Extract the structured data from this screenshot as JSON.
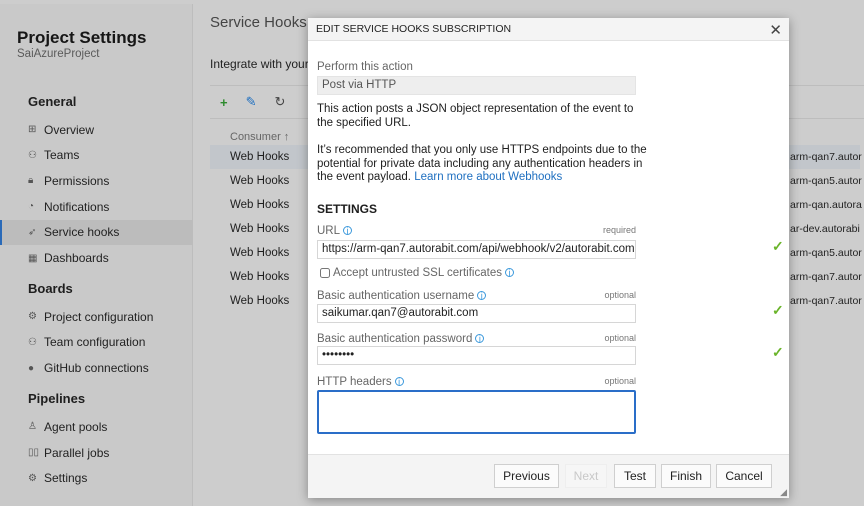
{
  "sidebar": {
    "title": "Project Settings",
    "project": "SaiAzureProject",
    "sections": [
      {
        "label": "General",
        "items": [
          {
            "label": "Overview",
            "icon": "overview-icon"
          },
          {
            "label": "Teams",
            "icon": "teams-icon"
          },
          {
            "label": "Permissions",
            "icon": "lock-icon"
          },
          {
            "label": "Notifications",
            "icon": "notification-icon"
          },
          {
            "label": "Service hooks",
            "icon": "rocket-icon",
            "selected": true
          },
          {
            "label": "Dashboards",
            "icon": "dashboard-icon"
          }
        ]
      },
      {
        "label": "Boards",
        "items": [
          {
            "label": "Project configuration",
            "icon": "project-config-icon"
          },
          {
            "label": "Team configuration",
            "icon": "team-config-icon"
          },
          {
            "label": "GitHub connections",
            "icon": "github-icon"
          }
        ]
      },
      {
        "label": "Pipelines",
        "items": [
          {
            "label": "Agent pools",
            "icon": "agent-icon"
          },
          {
            "label": "Parallel jobs",
            "icon": "parallel-icon"
          },
          {
            "label": "Settings",
            "icon": "gear-icon"
          }
        ]
      }
    ]
  },
  "main": {
    "title": "Service Hooks",
    "intro": "Integrate with your",
    "column_consumer": "Consumer ↑",
    "rows": [
      {
        "consumer": "Web Hooks",
        "url": "arm-qan7.autor"
      },
      {
        "consumer": "Web Hooks",
        "url": "arm-qan5.autor"
      },
      {
        "consumer": "Web Hooks",
        "url": "arm-qan.autora"
      },
      {
        "consumer": "Web Hooks",
        "url": "ar-dev.autorabi"
      },
      {
        "consumer": "Web Hooks",
        "url": "arm-qan5.autor"
      },
      {
        "consumer": "Web Hooks",
        "url": "arm-qan7.autor"
      },
      {
        "consumer": "Web Hooks",
        "url": "arm-qan7.autor"
      }
    ]
  },
  "dialog": {
    "title": "EDIT SERVICE HOOKS SUBSCRIPTION",
    "action_label": "Perform this action",
    "action_value": "Post via HTTP",
    "desc1": "This action posts a JSON object representation of the event to the specified URL.",
    "desc2": "It’s recommended that you only use HTTPS endpoints due to the potential for private data including any authentication headers in the event payload.",
    "learn_more": "Learn more about Webhooks",
    "settings": "SETTINGS",
    "url_label": "URL",
    "required": "required",
    "url_value": "https://arm-qan7.autorabit.com/api/webhook/v2/autorabit.com",
    "ssl_label": "Accept untrusted SSL certificates",
    "user_label": "Basic authentication username",
    "optional": "optional",
    "user_value": "saikumar.qan7@autorabit.com",
    "pass_label": "Basic authentication password",
    "pass_value": "••••••••",
    "headers_label": "HTTP headers",
    "buttons": {
      "previous": "Previous",
      "next": "Next",
      "test": "Test",
      "finish": "Finish",
      "cancel": "Cancel"
    }
  },
  "colors": {
    "accent": "#1e6fc0",
    "valid": "#6ab42a"
  }
}
